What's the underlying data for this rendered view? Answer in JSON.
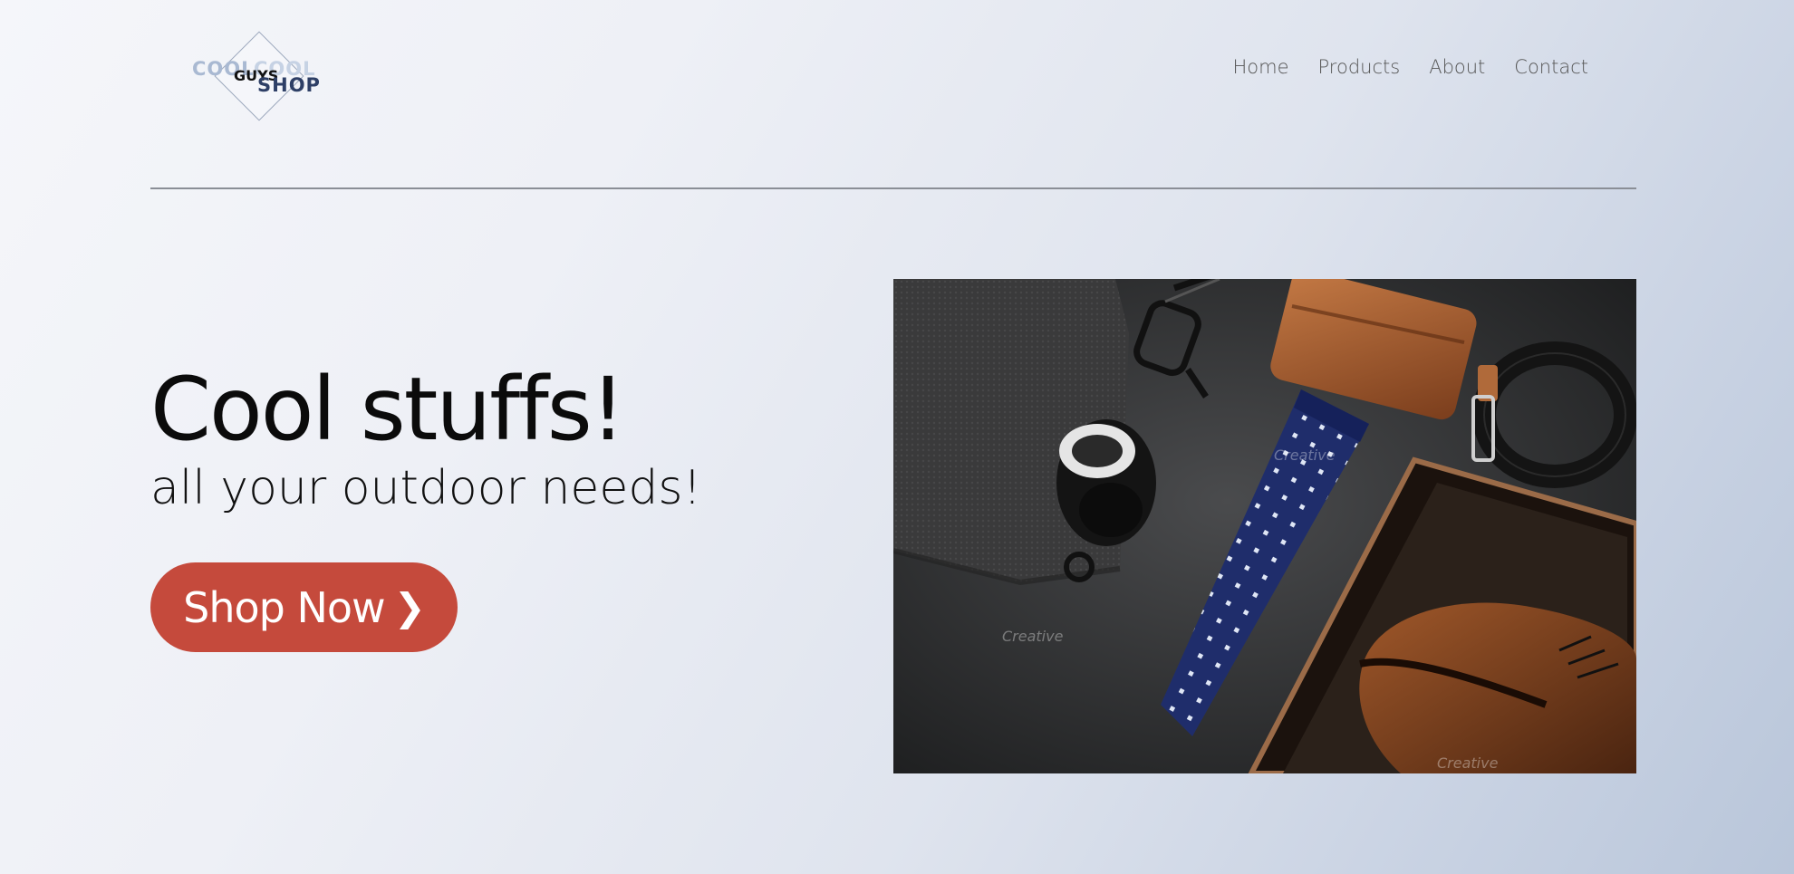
{
  "header": {
    "logo": {
      "word_top": "COOL",
      "word_middle": "GUYS",
      "word_bottom": "SHOP"
    },
    "nav": [
      {
        "label": "Home"
      },
      {
        "label": "Products"
      },
      {
        "label": "About"
      },
      {
        "label": "Contact"
      }
    ]
  },
  "hero": {
    "title": "Cool stuffs!",
    "subtitle": "all your outdoor needs!",
    "cta_label": "Shop Now",
    "cta_icon": "chevron-right-icon",
    "cta_icon_glyph": "❯"
  },
  "photo": {
    "watermark": "Creative"
  },
  "colors": {
    "accent": "#c54a3c",
    "logo_dark": "#2e3f66",
    "logo_light": "#a9b9d2",
    "divider": "#8a8e96",
    "nav_text": "#555555"
  }
}
